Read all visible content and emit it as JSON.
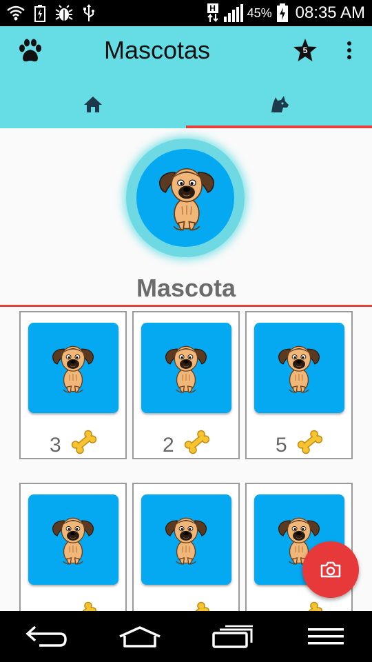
{
  "status_bar": {
    "battery_percent": "45%",
    "time": "08:35 AM",
    "network_badge": "H",
    "icons": [
      "wifi-icon",
      "battery-charging-icon",
      "bug-icon",
      "usb-icon",
      "signal-icon",
      "battery-icon"
    ]
  },
  "toolbar": {
    "title": "Mascotas",
    "star_count": "5",
    "icons": [
      "paw-icon",
      "star-icon",
      "overflow-menu-icon"
    ]
  },
  "tabs": [
    {
      "icon": "home-icon",
      "selected": false
    },
    {
      "icon": "dog-head-icon",
      "selected": true
    }
  ],
  "featured": {
    "name": "Mascota",
    "image": "dog-cartoon"
  },
  "pets": [
    {
      "likes": "3",
      "icon": "bone-icon"
    },
    {
      "likes": "2",
      "icon": "bone-icon"
    },
    {
      "likes": "5",
      "icon": "bone-icon"
    },
    {
      "likes": "",
      "icon": "bone-icon"
    },
    {
      "likes": "",
      "icon": "bone-icon"
    },
    {
      "likes": "",
      "icon": "bone-icon"
    }
  ],
  "fab": {
    "icon": "camera-icon"
  },
  "navigation_bar": {
    "icons": [
      "back-icon",
      "home-outline-icon",
      "recent-apps-icon",
      "menu-icon"
    ]
  },
  "colors": {
    "app_bar": "#66dde4",
    "accent": "#e5413a",
    "pet_background": "#05a9f1",
    "fab": "#e8393a"
  }
}
